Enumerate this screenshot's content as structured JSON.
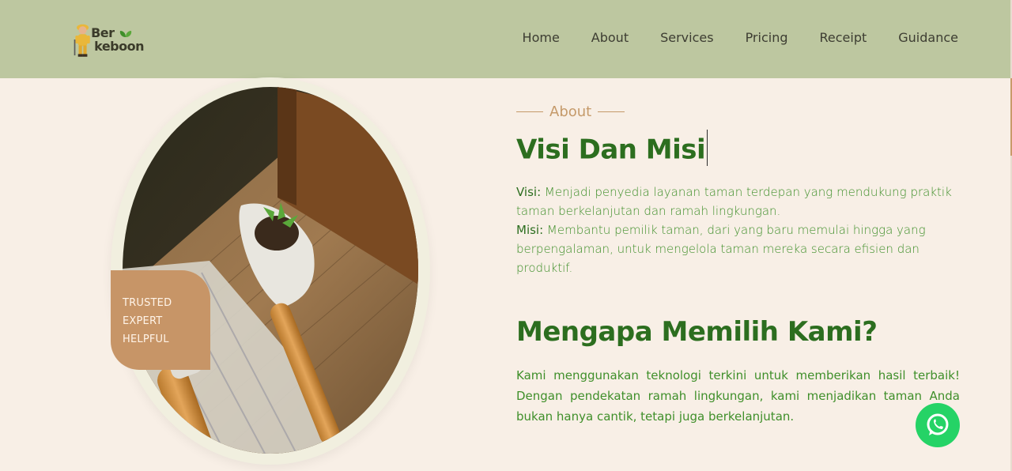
{
  "logo": {
    "line1": "Ber",
    "line2": "keboon"
  },
  "nav": {
    "items": [
      {
        "label": "Home"
      },
      {
        "label": "About"
      },
      {
        "label": "Services"
      },
      {
        "label": "Pricing"
      },
      {
        "label": "Receipt"
      },
      {
        "label": "Guidance"
      }
    ]
  },
  "badge": {
    "line1": "TRUSTED",
    "line2": "EXPERT",
    "line3": "HELPFUL"
  },
  "about": {
    "label": "About",
    "title": "Visi Dan Misi",
    "visi_label": "Visi:",
    "visi_text": " Menjadi penyedia layanan taman terdepan yang mendukung praktik taman berkelanjutan dan ramah lingkungan.",
    "misi_label": "Misi:",
    "misi_text": " Membantu pemilik taman, dari yang baru memulai hingga yang berpengalaman, untuk mengelola taman mereka secara efisien dan produktif."
  },
  "why": {
    "title": "Mengapa Memilih Kami?",
    "text": "Kami menggunakan teknologi terkini untuk memberikan hasil terbaik! Dengan pendekatan ramah lingkungan, kami menjadikan taman Anda bukan hanya cantik, tetapi juga berkelanjutan."
  },
  "colors": {
    "header": "#bdc7a0",
    "background": "#f8efe6",
    "accent_green": "#2c6e1f",
    "accent_tan": "#c79567",
    "whatsapp": "#25d366"
  },
  "icons": {
    "whatsapp": "whatsapp-icon",
    "logo": "gardener-mascot-icon"
  }
}
